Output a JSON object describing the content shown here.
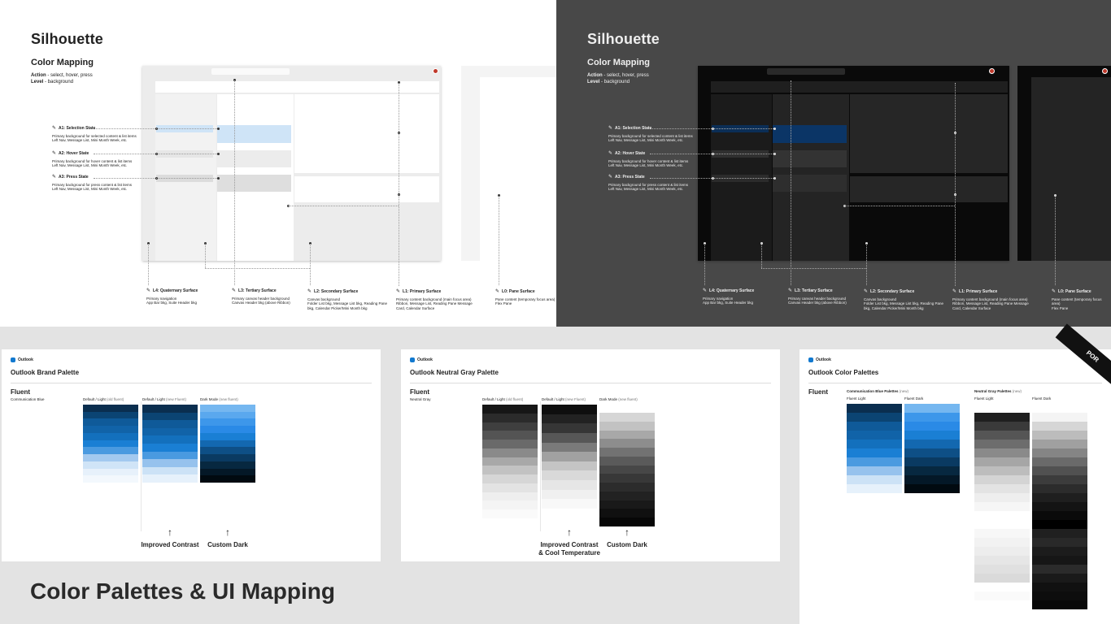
{
  "title": "Color Palettes & UI Mapping",
  "silhouette": {
    "title": "Silhouette",
    "subtitle": "Color Mapping",
    "legend_action_key": "Action",
    "legend_action_val": " - select, hover, press",
    "legend_level_key": "Level",
    "legend_level_val": " - background",
    "states": [
      {
        "title": "A1: Selection State",
        "desc": "Primary background for selected content & list items",
        "ex": "Left Nav, Message List, Mini Month Week, etc."
      },
      {
        "title": "A2: Hover State",
        "desc": "Primary background for hover content & list items",
        "ex": "Left Nav, Message List, Mini Month Week, etc."
      },
      {
        "title": "A3: Press State",
        "desc": "Primary background for press content & list items",
        "ex": "Left Nav, Message List, Mini Month Week, etc."
      }
    ],
    "levels": [
      {
        "title": "L4: Quaternary Surface",
        "desc": "Primary navigation",
        "ex": "App Bar bkg, Suite Header bkg"
      },
      {
        "title": "L3: Tertiary Surface",
        "desc": "Primary canvas header background",
        "ex": "Canvas Header bkg (above Ribbon)"
      },
      {
        "title": "L2: Secondary Surface",
        "desc": "Canvas background",
        "ex": "Folder List bkg, Message List bkg, Reading Pane bkg, Calendar Picker/Mini Month bkg"
      },
      {
        "title": "L1: Primary Surface",
        "desc": "Primary content background (main focus area)",
        "ex": "Ribbon, Message List, Reading Pane Message Card, Calendar Surface"
      },
      {
        "title": "L0: Pane Surface",
        "desc": "Pane content (temporary focus area)",
        "ex": "Flex Pane"
      }
    ]
  },
  "cards": {
    "logo": "Outlook",
    "fluent": "Fluent",
    "brand": {
      "title": "Outlook Brand Palette",
      "sub": "Communication Blue",
      "col1": "Default / Light",
      "col1b": " (old fluent)",
      "col2": "Default / Light",
      "col2b": " (new Fluent)",
      "col3": "Dark Mode",
      "col3b": " (new fluent)",
      "callout1": "Improved Contrast",
      "callout2": "Custom Dark",
      "c1": [
        "#0a2e4f",
        "#0b4473",
        "#0f5a99",
        "#1163a8",
        "#1370bd",
        "#1a7fd4",
        "#4a9ae0",
        "#a3c9ef",
        "#d0e4f7",
        "#e7f1fb",
        "#f3f8fd"
      ],
      "c2": [
        "#0a2e4f",
        "#0b4473",
        "#0f5a99",
        "#1163a8",
        "#1370bd",
        "#1a7fd4",
        "#4a9ae0",
        "#96c2ed",
        "#cce2f6",
        "#e6f1fb"
      ],
      "c3": [
        "#75b7f0",
        "#5aa8ee",
        "#3d97ea",
        "#2a8ae6",
        "#1a7fd4",
        "#1368b0",
        "#0e4f86",
        "#0a3a62",
        "#072840",
        "#041827",
        "#010a10"
      ]
    },
    "gray": {
      "title": "Outlook Neutral Gray Palette",
      "sub": "Neutral Gray",
      "col1": "Default / Light",
      "col1b": " (old fluent)",
      "col2": "Default / Light",
      "col2b": " (new Fluent)",
      "col3": "Dark Mode",
      "col3b": " (new fluent)",
      "callout1a": "Improved Contrast",
      "callout1b": "& Cool Temperature",
      "callout2": "Custom Dark",
      "c1": [
        "#161616",
        "#2b2b2b",
        "#3f3f3f",
        "#545454",
        "#6a6a6a",
        "#8a8a8a",
        "#a8a8a8",
        "#c2c2c2",
        "#d6d6d6",
        "#e3e3e3",
        "#eeeeee",
        "#f4f4f4",
        "#fafafa"
      ],
      "c2": [
        "#0e0e0e",
        "#222222",
        "#363636",
        "#575757",
        "#7a7a7a",
        "#a1a1a1",
        "#c4c4c4",
        "#d9d9d9",
        "#e6e6e6",
        "#f0f0f0",
        "#f8f8f8"
      ],
      "c3": [
        "#d6d6d6",
        "#c2c2c2",
        "#a8a8a8",
        "#8d8d8d",
        "#727272",
        "#5a5a5a",
        "#474747",
        "#383838",
        "#2c2c2c",
        "#222222",
        "#191919",
        "#101010",
        "#070707"
      ]
    },
    "palettes": {
      "title": "Outlook Color Palettes",
      "comm_h": "Communication Blue Palettes",
      "comm_hb": " (new)",
      "neutral_h": "Neutral Gray Palettes",
      "neutral_hb": " (new)",
      "fl": "Fluent Light",
      "fd": "Fluent Dark",
      "badge": "POR"
    }
  }
}
